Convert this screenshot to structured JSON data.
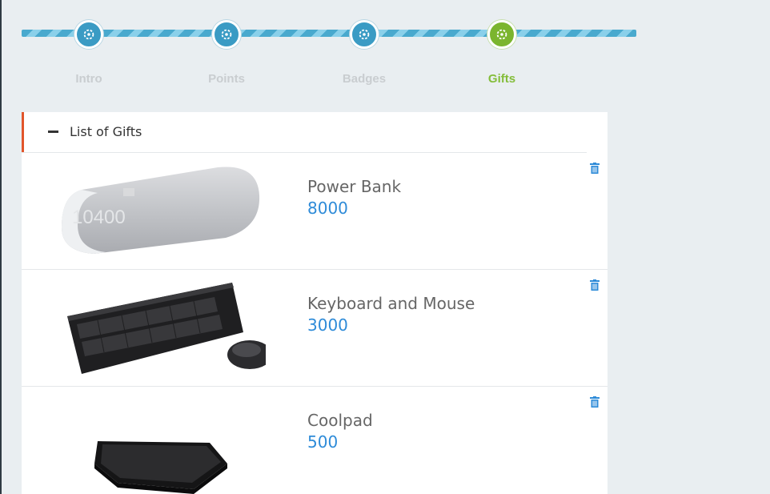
{
  "stepper": {
    "steps": [
      {
        "label": "Intro",
        "icon": "gear-icon",
        "active": false
      },
      {
        "label": "Points",
        "icon": "gear-icon",
        "active": false
      },
      {
        "label": "Badges",
        "icon": "gear-icon",
        "active": false
      },
      {
        "label": "Gifts",
        "icon": "gear-icon",
        "active": true
      }
    ]
  },
  "panel": {
    "title": "List of Gifts",
    "collapse_icon": "minus-icon"
  },
  "gifts": [
    {
      "name": "Power Bank",
      "points": "8000",
      "image": "power-bank-image",
      "action_icon": "trash-icon"
    },
    {
      "name": "Keyboard and Mouse",
      "points": "3000",
      "image": "keyboard-mouse-image",
      "action_icon": "trash-icon"
    },
    {
      "name": "Coolpad",
      "points": "500",
      "image": "coolpad-image",
      "action_icon": "trash-icon"
    }
  ],
  "colors": {
    "step_blue": "#3a9bc4",
    "step_active_green": "#7bb52e",
    "points_blue": "#2e8bd8",
    "header_accent": "#e1552b"
  }
}
